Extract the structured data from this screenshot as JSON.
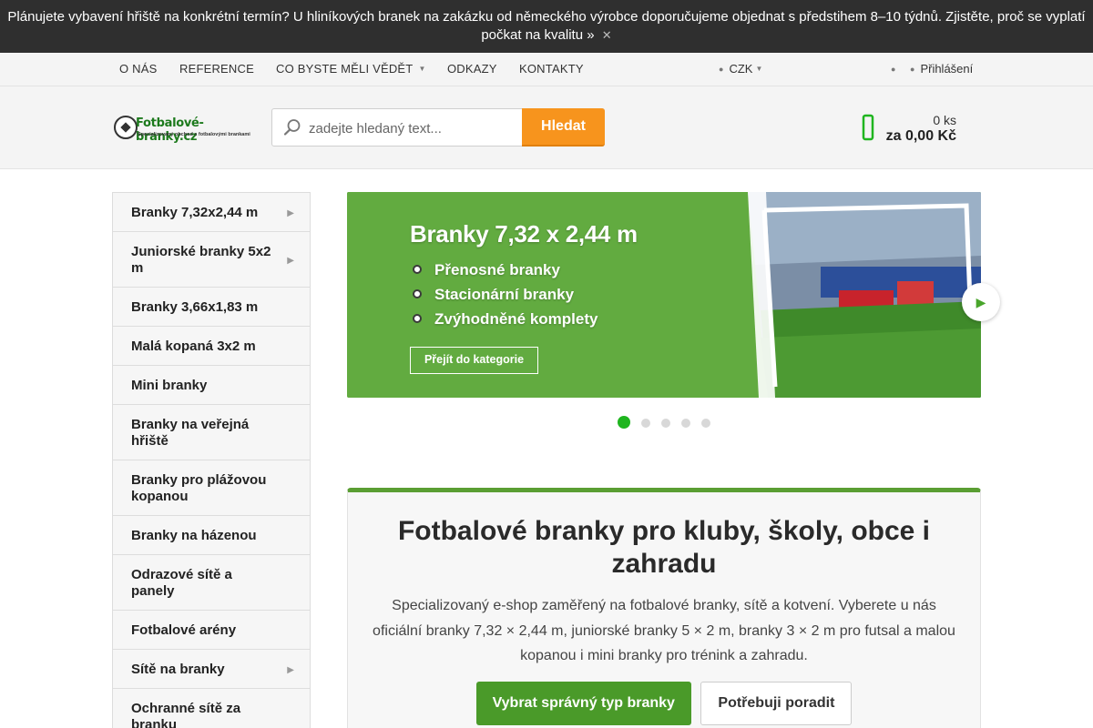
{
  "notice": {
    "text": "Plánujete vybavení hřiště na konkrétní termín? U hliníkových branek na zakázku od německého výrobce doporučujeme objednat s předstihem 8–10 týdnů. Zjistěte, proč se vyplatí počkat na kvalitu »",
    "close_icon": "close-icon"
  },
  "topnav": {
    "links": [
      "O NÁS",
      "REFERENCE",
      "CO BYSTE MĚLI VĚDĚT",
      "ODKAZY",
      "KONTAKTY"
    ],
    "currency": "CZK",
    "login": "Přihlášení"
  },
  "header": {
    "logo_name": "Fotbalové-branky.cz",
    "logo_tagline": "Specializovaný obchod s fotbalovými brankami",
    "search_placeholder": "zadejte hledaný text...",
    "search_button": "Hledat",
    "cart_qty": "0 ks",
    "cart_total": "za 0,00 Kč"
  },
  "sidebar": {
    "items": [
      {
        "label": "Branky 7,32x2,44 m",
        "has_sub": true
      },
      {
        "label": "Juniorské branky 5x2 m",
        "has_sub": true
      },
      {
        "label": "Branky 3,66x1,83 m",
        "has_sub": false
      },
      {
        "label": "Malá kopaná 3x2 m",
        "has_sub": false
      },
      {
        "label": "Mini branky",
        "has_sub": false
      },
      {
        "label": "Branky na veřejná hřiště",
        "has_sub": false
      },
      {
        "label": "Branky pro plážovou kopanou",
        "has_sub": false
      },
      {
        "label": "Branky na házenou",
        "has_sub": false
      },
      {
        "label": "Odrazové sítě a panely",
        "has_sub": false
      },
      {
        "label": "Fotbalové arény",
        "has_sub": false
      },
      {
        "label": "Sítě na branky",
        "has_sub": true
      },
      {
        "label": "Ochranné sítě za branku",
        "has_sub": false
      }
    ]
  },
  "slider": {
    "title": "Branky 7,32 x 2,44 m",
    "bullets": [
      "Přenosné branky",
      "Stacionární branky",
      "Zvýhodněné komplety"
    ],
    "cta": "Přejít do kategorie",
    "active_index": 0,
    "dot_count": 5
  },
  "intro": {
    "title": "Fotbalové branky pro kluby, školy, obce i zahradu",
    "text": "Specializovaný e-shop zaměřený na fotbalové branky, sítě a kotvení. Vyberete u nás oficiální branky 7,32 × 2,44 m, juniorské branky 5 × 2 m, branky 3 × 2 m pro futsal a malou kopanou i mini branky pro trénink a zahradu.",
    "primary_button": "Vybrat správný typ branky",
    "secondary_button": "Potřebuji poradit"
  },
  "colors": {
    "accent_orange": "#f7941d",
    "brand_green": "#4a9a29",
    "notice_bg": "#2f2f2f"
  }
}
